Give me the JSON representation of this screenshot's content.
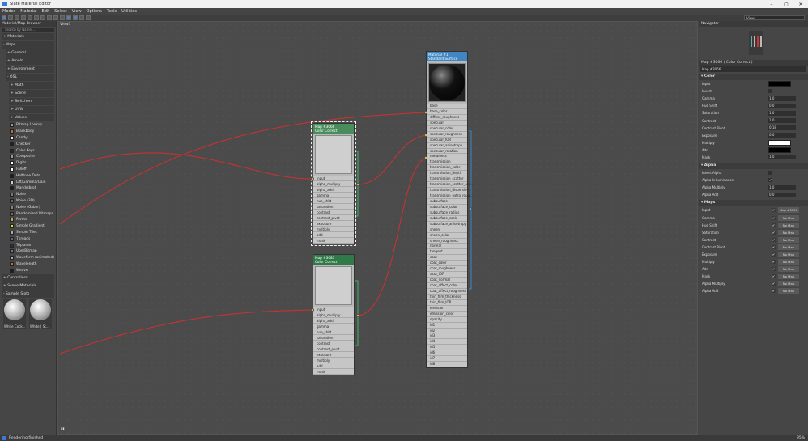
{
  "window": {
    "title": "Slate Material Editor",
    "min": "–",
    "max": "▢",
    "close": "✕"
  },
  "menu": [
    "Modes",
    "Material",
    "Edit",
    "Select",
    "View",
    "Options",
    "Tools",
    "Utilities"
  ],
  "toolbar": {
    "view_selector": "View1"
  },
  "browser": {
    "title": "Material/Map Browser",
    "search_placeholder": "Search by Name ...",
    "groups": [
      {
        "label": "+ Materials",
        "level": 1
      },
      {
        "label": "- Maps",
        "level": 1
      },
      {
        "label": "+ General",
        "level": 2
      },
      {
        "label": "+ Arnold",
        "level": 2
      },
      {
        "label": "+ Environment",
        "level": 2
      },
      {
        "label": "- OSL",
        "level": 2
      },
      {
        "label": "+ Math",
        "level": 3
      },
      {
        "label": "+ Scene",
        "level": 3
      },
      {
        "label": "+ Switchers",
        "level": 3
      },
      {
        "label": "+ UVW",
        "level": 3
      },
      {
        "label": "+ Values",
        "level": 3
      }
    ],
    "maps": [
      {
        "label": "Bitmap Lookup",
        "color": "#8a9ab8"
      },
      {
        "label": "Blackbody",
        "color": "#c86a2a"
      },
      {
        "label": "Candy",
        "color": "#e8e8e8"
      },
      {
        "label": "Checker",
        "color": "#222222"
      },
      {
        "label": "Color Keys",
        "color": "#2a2a2a"
      },
      {
        "label": "Composite",
        "color": "#8aa0b0"
      },
      {
        "label": "Digits",
        "color": "#ffffff"
      },
      {
        "label": "Falloff",
        "color": "#ffffff"
      },
      {
        "label": "Halftone Dots",
        "color": "#202020"
      },
      {
        "label": "Lift/Gamma/Gain",
        "color": "#cfcfcf"
      },
      {
        "label": "Mandelbrot",
        "color": "#1a1a1a"
      },
      {
        "label": "Noise",
        "color": "#777777"
      },
      {
        "label": "Noise (3D)",
        "color": "#666666"
      },
      {
        "label": "Noise (Gabor)",
        "color": "#888888"
      },
      {
        "label": "Randomized Bitmaps",
        "color": "#7a6a5a"
      },
      {
        "label": "Rivets",
        "color": "#b8b040"
      },
      {
        "label": "Simple Gradient",
        "color": "#e0e020"
      },
      {
        "label": "Simple Tiles",
        "color": "#aaaaaa"
      },
      {
        "label": "Threads",
        "color": "#6a6a6a"
      },
      {
        "label": "Triplanar",
        "color": "#303030"
      },
      {
        "label": "UberBitmap",
        "color": "#5a7aa0"
      },
      {
        "label": "Waveform (animated)",
        "color": "#aaaaaa"
      },
      {
        "label": "Wavelength",
        "color": "#e0602a"
      },
      {
        "label": "Weave",
        "color": "#202020"
      }
    ],
    "bottom_groups": [
      "+ Controllers",
      "+ Scene Materials",
      "- Sample Slots"
    ],
    "slots": [
      "White Cock...",
      "White ( St..."
    ]
  },
  "view": {
    "tab": "View1",
    "icon": "▮▮"
  },
  "nodes": {
    "std": {
      "title1": "Material #1",
      "title2": "Standard Surface",
      "slots": [
        "base",
        "base_color",
        "diffuse_roughness",
        "specular",
        "specular_color",
        "specular_roughness",
        "specular_IOR",
        "specular_anisotropy",
        "specular_rotation",
        "metalness",
        "transmission",
        "transmission_color",
        "transmission_depth",
        "transmission_scatter",
        "transmission_scatter_ani...",
        "transmission_dispersion",
        "transmission_extra_roug...",
        "subsurface",
        "subsurface_color",
        "subsurface_radius",
        "subsurface_scale",
        "subsurface_anisotropy",
        "sheen",
        "sheen_color",
        "sheen_roughness",
        "normal",
        "tangent",
        "coat",
        "coat_color",
        "coat_roughness",
        "coat_IOR",
        "coat_normal",
        "coat_affect_color",
        "coat_affect_roughness",
        "thin_film_thickness",
        "thin_film_IOR",
        "emission",
        "emission_color",
        "opacity",
        "id1",
        "id2",
        "id3",
        "id4",
        "id5",
        "id6",
        "id7",
        "id8"
      ]
    },
    "cc1": {
      "title1": "Map #3066",
      "title2": "Color Correct",
      "slots": [
        "input",
        "alpha_multiply",
        "alpha_add",
        "gamma",
        "hue_shift",
        "saturation",
        "contrast",
        "contrast_pivot",
        "exposure",
        "multiply",
        "add",
        "mask"
      ]
    },
    "cc2": {
      "title1": "Map #3083",
      "title2": "Color Correct",
      "slots": [
        "input",
        "alpha_multiply",
        "alpha_add",
        "gamma",
        "hue_shift",
        "saturation",
        "contrast",
        "contrast_pivot",
        "exposure",
        "multiply",
        "add",
        "mask"
      ]
    }
  },
  "navigator": {
    "title": "Navigator"
  },
  "params": {
    "title": "Map #3066  ( Color Correct )",
    "name": "Map #3066",
    "color_section": "Color",
    "color_rows": [
      {
        "label": "Input",
        "type": "swatch",
        "value": "",
        "color": "#000000"
      },
      {
        "label": "Invert",
        "type": "check",
        "value": ""
      },
      {
        "label": "Gamma",
        "type": "spin",
        "value": "1.0"
      },
      {
        "label": "Hue Shift",
        "type": "spin",
        "value": "0.0"
      },
      {
        "label": "Saturation",
        "type": "spin",
        "value": "1.0"
      },
      {
        "label": "Contrast",
        "type": "spin",
        "value": "1.0"
      },
      {
        "label": "Contrast Pivot",
        "type": "spin",
        "value": "0.18"
      },
      {
        "label": "Exposure",
        "type": "spin",
        "value": "0.0"
      },
      {
        "label": "Multiply",
        "type": "swatch",
        "value": "",
        "color": "#ffffff"
      },
      {
        "label": "Add",
        "type": "swatch",
        "value": "",
        "color": "#000000"
      },
      {
        "label": "Mask",
        "type": "spin",
        "value": "1.0"
      }
    ],
    "alpha_section": "Alpha",
    "alpha_rows": [
      {
        "label": "Invert Alpha",
        "type": "check",
        "value": ""
      },
      {
        "label": "Alpha Is Luminance",
        "type": "check",
        "value": "✔"
      },
      {
        "label": "Alpha Multiply",
        "type": "spin",
        "value": "1.0"
      },
      {
        "label": "Alpha Add",
        "type": "spin",
        "value": "0.0"
      }
    ],
    "maps_section": "Maps",
    "map_rows": [
      {
        "label": "Input",
        "btn": "Map #3130"
      },
      {
        "label": "Gamma",
        "btn": "No Map"
      },
      {
        "label": "Hue Shift",
        "btn": "No Map"
      },
      {
        "label": "Saturation",
        "btn": "No Map"
      },
      {
        "label": "Contrast",
        "btn": "No Map"
      },
      {
        "label": "Contrast Pivot",
        "btn": "No Map"
      },
      {
        "label": "Exposure",
        "btn": "No Map"
      },
      {
        "label": "Multiply",
        "btn": "No Map"
      },
      {
        "label": "Add",
        "btn": "No Map"
      },
      {
        "label": "Mask",
        "btn": "No Map"
      },
      {
        "label": "Alpha Multiply",
        "btn": "No Map"
      },
      {
        "label": "Alpha Add",
        "btn": "No Map"
      }
    ]
  },
  "status": {
    "text": "Rendering finished",
    "zoom": "95%"
  }
}
